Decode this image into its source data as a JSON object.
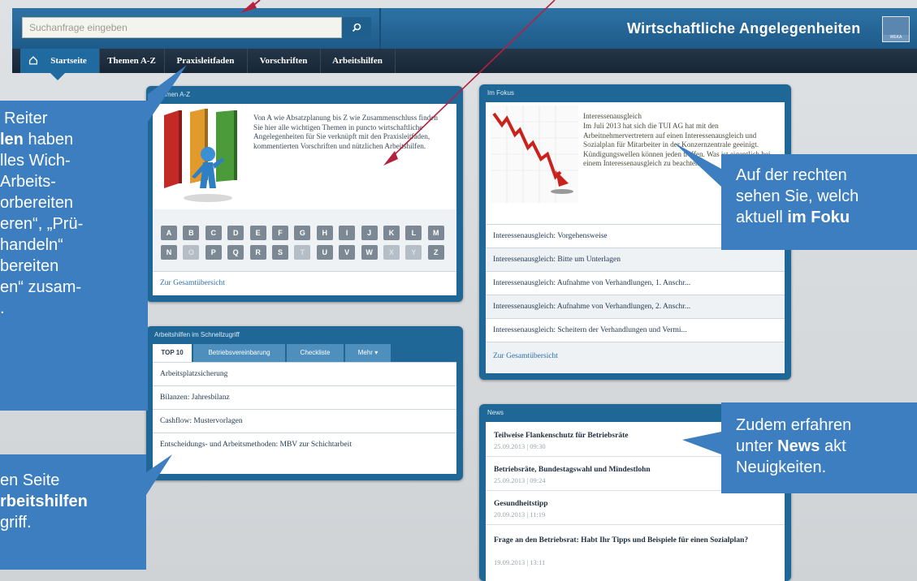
{
  "header": {
    "search_placeholder": "Suchanfrage eingeben",
    "app_title": "Wirtschaftliche Angelegenheiten",
    "logo_text": "WEKA"
  },
  "nav": {
    "items": [
      {
        "label": "Startseite"
      },
      {
        "label": "Themen A-Z"
      },
      {
        "label": "Praxisleitfaden"
      },
      {
        "label": "Vorschriften"
      },
      {
        "label": "Arbeitshilfen"
      }
    ]
  },
  "themen": {
    "title": "Themen A-Z",
    "intro": "Von A wie Absatzplanung bis Z wie Zusammenschluss finden Sie hier alle wichtigen Themen in puncto wirtschaftliche Angelegenheiten für Sie verknüpft mit den Praxisleitfaden, kommentierten Vorschriften und nützlichen Arbeitshilfen.",
    "letters_row1": [
      "A",
      "B",
      "C",
      "D",
      "E",
      "F",
      "G",
      "H",
      "I",
      "J",
      "K",
      "L",
      "M"
    ],
    "letters_row2": [
      "N",
      "O",
      "P",
      "Q",
      "R",
      "S",
      "T",
      "U",
      "V",
      "W",
      "X",
      "Y",
      "Z"
    ],
    "disabled_letters": [
      "O",
      "T",
      "X",
      "Y"
    ],
    "overview_link": "Zur Gesamtübersicht"
  },
  "arbeitshilfen": {
    "title": "Arbeitshilfen im Schnellzugriff",
    "tabs": [
      {
        "label": "TOP 10"
      },
      {
        "label": "Betriebsvereinbarung"
      },
      {
        "label": "Checkliste"
      },
      {
        "label": "Mehr ▾"
      }
    ],
    "rows": [
      "Arbeitsplatzsicherung",
      "Bilanzen: Jahresbilanz",
      "Cashflow: Mustervorlagen",
      "Entscheidungs- und Arbeitsmethoden: MBV zur Schichtarbeit"
    ]
  },
  "fokus": {
    "title": "Im Fokus",
    "headline": "Interessenausgleich",
    "text": "Im Juli 2013 hat sich die TUI AG hat mit den Arbeitnehmervertretern auf einen Interessenausgleich und Sozialplan für Mitarbeiter in der Konzernzentrale geeinigt. Kündigungswellen können jeden treffen. Was ist eigentlich bei einem Interessenausgleich zu beachten?",
    "rows": [
      "Interessenausgleich: Vorgehensweise",
      "Interessenausgleich: Bitte um Unterlagen",
      "Interessenausgleich: Aufnahme von Verhandlungen, 1. Anschr...",
      "Interessenausgleich: Aufnahme von Verhandlungen, 2. Anschr...",
      "Interessenausgleich: Scheitern der Verhandlungen und Vermi..."
    ],
    "overview_link": "Zur Gesamtübersicht"
  },
  "news": {
    "title": "News",
    "items": [
      {
        "title": "Teilweise Flankenschutz für Betriebsräte",
        "date": "25.09.2013 | 09:30"
      },
      {
        "title": "Betriebsräte, Bundestagswahl und Mindestlohn",
        "date": "25.09.2013 | 09:24"
      },
      {
        "title": "Gesundheitstipp",
        "date": "20.09.2013 | 11:19"
      },
      {
        "title": "Frage an den Betriebsrat: Habt Ihr Tipps und Beispiele für einen Sozialplan?",
        "date": "19.09.2013 | 13:11"
      }
    ]
  },
  "callouts": {
    "left_top": {
      "l1": "Reiter",
      "l2_bold": "len",
      "l2_rest": " haben",
      "l3": "lles Wich-",
      "l4": "Arbeits-",
      "l5": "orbereiten",
      "l6": "eren“, „Prü-",
      "l7": "handeln“",
      "l8": "bereiten",
      "l9": "en“ zusam-",
      "l10": "."
    },
    "left_bottom": {
      "l1": "en Seite",
      "l2_bold": "rbeitshilfen",
      "l3": "griff."
    },
    "right_top": {
      "l1": "Auf der rechten",
      "l2": "sehen Sie, welch",
      "l3_pre": "aktuell ",
      "l3_bold": "im Foku"
    },
    "right_bottom": {
      "l1": "Zudem erfahren",
      "l2_pre": "unter ",
      "l2_bold": "News",
      "l2_post": " akt",
      "l3": "Neuigkeiten."
    }
  },
  "colors": {
    "header_blue": "#2e73a6",
    "nav_dark": "#1a2a3a",
    "panel_blue": "#1f6797",
    "callout_blue": "#3c7ec0",
    "arrow_red": "#b3223d"
  }
}
